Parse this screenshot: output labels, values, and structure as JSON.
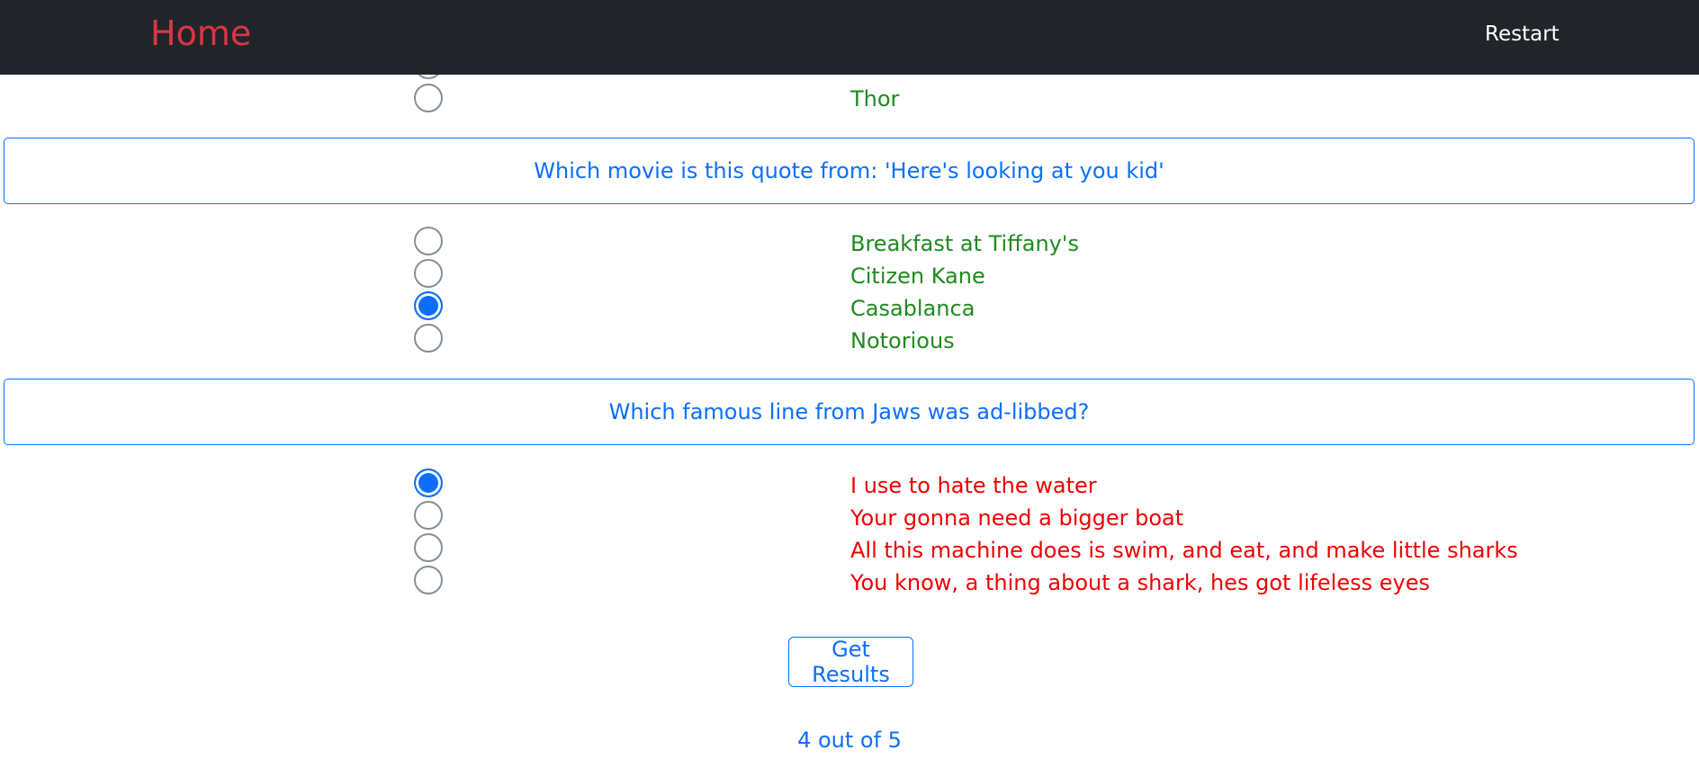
{
  "navbar": {
    "brand": "Home",
    "restart": "Restart"
  },
  "questions": [
    {
      "text": "",
      "answers": [
        {
          "label": "",
          "checked": false,
          "color": "green"
        },
        {
          "label": "Thor",
          "checked": false,
          "color": "green"
        }
      ]
    },
    {
      "text": "Which movie is this quote from: 'Here's looking at you kid'",
      "answers": [
        {
          "label": "Breakfast at Tiffany's",
          "checked": false,
          "color": "green"
        },
        {
          "label": "Citizen Kane",
          "checked": false,
          "color": "green"
        },
        {
          "label": "Casablanca",
          "checked": true,
          "color": "green"
        },
        {
          "label": "Notorious",
          "checked": false,
          "color": "green"
        }
      ]
    },
    {
      "text": "Which famous line from Jaws was ad-libbed?",
      "answers": [
        {
          "label": "I use to hate the water",
          "checked": true,
          "color": "red"
        },
        {
          "label": "Your gonna need a bigger boat",
          "checked": false,
          "color": "red"
        },
        {
          "label": "All this machine does is swim, and eat, and make little sharks",
          "checked": false,
          "color": "red"
        },
        {
          "label": "You know, a thing about a shark, hes got lifeless eyes",
          "checked": false,
          "color": "red"
        }
      ]
    }
  ],
  "results_button": "Get Results",
  "score": "4 out of 5",
  "colors": {
    "navbar_bg": "#212529",
    "brand": "#dc3545",
    "primary": "#0d6efd",
    "correct": "#1f8a1f",
    "incorrect": "#f00000"
  }
}
